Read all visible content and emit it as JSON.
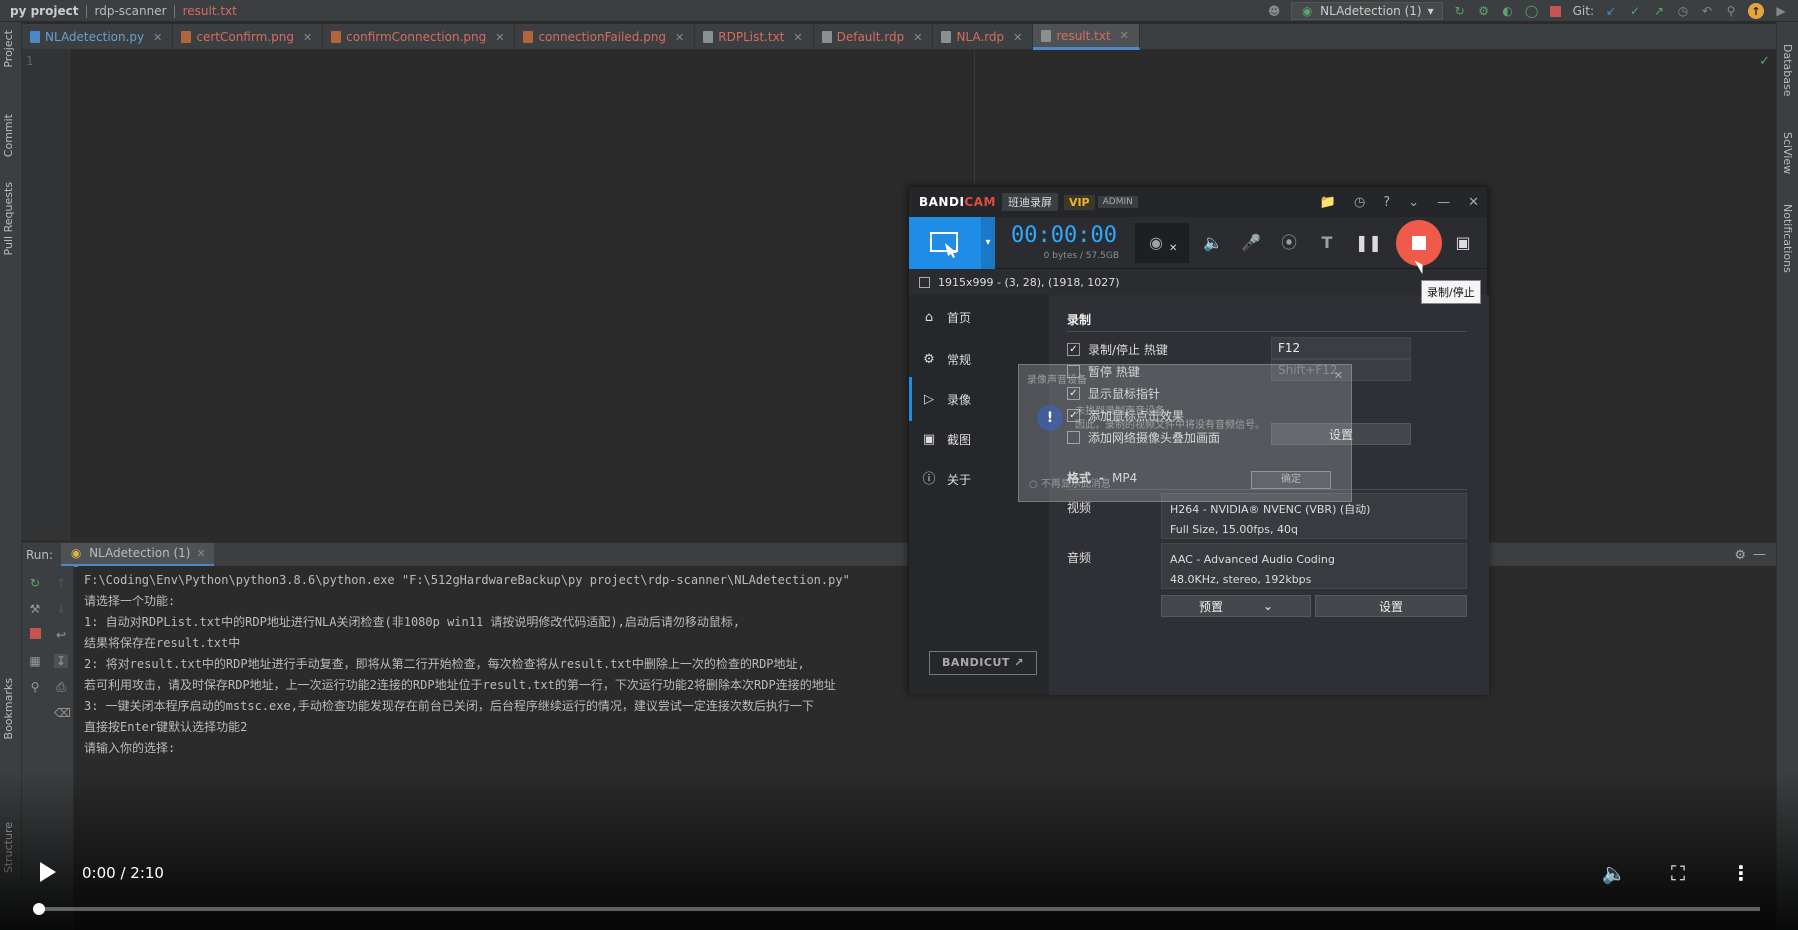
{
  "ide": {
    "breadcrumb": [
      "py project",
      "rdp-scanner",
      "result.txt"
    ],
    "run_config": "NLAdetection (1)",
    "git_label": "Git:",
    "tabs": [
      {
        "label": "NLAdetection.py",
        "type": "py"
      },
      {
        "label": "certConfirm.png",
        "type": "png"
      },
      {
        "label": "confirmConnection.png",
        "type": "png"
      },
      {
        "label": "connectionFailed.png",
        "type": "png"
      },
      {
        "label": "RDPList.txt",
        "type": "txt"
      },
      {
        "label": "Default.rdp",
        "type": "rdp"
      },
      {
        "label": "NLA.rdp",
        "type": "rdp"
      },
      {
        "label": "result.txt",
        "type": "txt",
        "active": true
      }
    ],
    "left_tools": [
      "Project",
      "Commit",
      "Pull Requests",
      "Bookmarks",
      "Structure"
    ],
    "right_tools": [
      "Database",
      "SciView",
      "Notifications"
    ],
    "line_number": "1",
    "run": {
      "label": "Run:",
      "tab": "NLAdetection (1)",
      "console": [
        "F:\\Coding\\Env\\Python\\python3.8.6\\python.exe \"F:\\512gHardwareBackup\\py project\\rdp-scanner\\NLAdetection.py\"",
        "请选择一个功能:",
        "1: 自动对RDPList.txt中的RDP地址进行NLA关闭检查(非1080p win11 请按说明修改代码适配),启动后请勿移动鼠标,",
        "    结果将保存在result.txt中",
        "2: 将对result.txt中的RDP地址进行手动复查，即将从第二行开始检查，每次检查将从result.txt中删除上一次的检查的RDP地址,",
        "    若可利用攻击，请及时保存RDP地址，上一次运行功能2连接的RDP地址位于result.txt的第一行，下次运行功能2将删除本次RDP连接的地址",
        "3: 一键关闭本程序启动的mstsc.exe,手动检查功能发现存在前台已关闭，后台程序继续运行的情况，建议尝试一定连接次数后执行一下",
        "直接按Enter键默认选择功能2",
        "请输入你的选择:"
      ]
    }
  },
  "bandicam": {
    "logo_a": "BANDI",
    "logo_b": "CAM",
    "cn_name": "班迪录屏",
    "vip": "VIP",
    "admin": "ADMIN",
    "timer": "00:00:00",
    "bytes": "0 bytes / 57.5GB",
    "resolution": "1915x999 - (3, 28), (1918, 1027)",
    "nav": [
      "首页",
      "常规",
      "录像",
      "截图",
      "关于"
    ],
    "section_record": "录制",
    "options": [
      {
        "label": "录制/停止 热键",
        "checked": true
      },
      {
        "label": "暂停 热键",
        "checked": false
      },
      {
        "label": "显示鼠标指针",
        "checked": true
      },
      {
        "label": "添加鼠标点击效果",
        "checked": true
      },
      {
        "label": "添加网络摄像头叠加画面",
        "checked": false
      }
    ],
    "hotkey_record": "F12",
    "hotkey_pause": "Shift+F12",
    "settings_btn": "设置",
    "format_label": "格式",
    "format_value": "MP4",
    "video_label": "视频",
    "video_line1": "H264 - NVIDIA® NVENC (VBR) (自动)",
    "video_line2": "Full Size, 15.00fps, 40q",
    "audio_label": "音频",
    "audio_line1": "AAC - Advanced Audio Coding",
    "audio_line2": "48.0KHz, stereo, 192kbps",
    "preset_btn": "预置",
    "settings_btn2": "设置",
    "bandicut": "BANDICUT",
    "tooltip": "录制/停止"
  },
  "ghost_dialog": {
    "title": "录像声音设备",
    "message_1": "未找到录制声音设备。",
    "message_2": "因此，录制的视频文件中将没有音频信号。",
    "dont_show": "不再显示此消息",
    "ok": "确定"
  },
  "video_player": {
    "time": "0:00 / 2:10",
    "progress": 0.0
  }
}
